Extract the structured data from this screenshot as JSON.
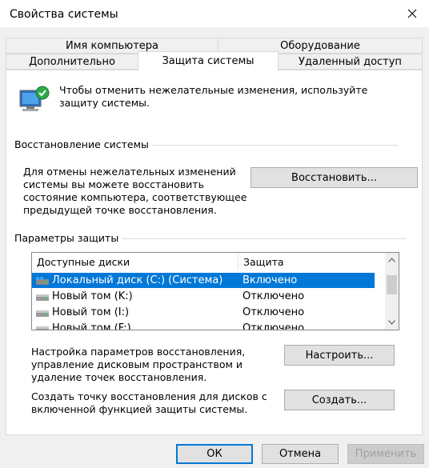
{
  "window": {
    "title": "Свойства системы"
  },
  "tabs_back": [
    "Имя компьютера",
    "Оборудование"
  ],
  "tabs_front": [
    "Дополнительно",
    "Защита системы",
    "Удаленный доступ"
  ],
  "intro": {
    "line1": "Чтобы отменить нежелательные изменения, используйте",
    "line2": "защиту системы."
  },
  "restore": {
    "header": "Восстановление системы",
    "desc": [
      "Для отмены нежелательных изменений",
      "системы вы можете восстановить",
      "состояние компьютера, соответствующее",
      "предыдущей точке восстановления."
    ],
    "button": "Восстановить..."
  },
  "protection": {
    "header": "Параметры защиты",
    "columns": [
      "Доступные диски",
      "Защита"
    ],
    "rows": [
      {
        "name": "Локальный диск (C:) (Система)",
        "status": "Включено",
        "selected": true,
        "icon": "system-drive-icon"
      },
      {
        "name": "Новый том (K:)",
        "status": "Отключено",
        "selected": false,
        "icon": "drive-icon"
      },
      {
        "name": "Новый том (I:)",
        "status": "Отключено",
        "selected": false,
        "icon": "drive-icon"
      },
      {
        "name": "Новый том (F:)",
        "status": "Отключено",
        "selected": false,
        "icon": "drive-icon"
      }
    ],
    "configure_desc": [
      "Настройка параметров восстановления,",
      "управление дисковым пространством и",
      "удаление точек восстановления."
    ],
    "configure_button": "Настроить...",
    "create_desc": [
      "Создать точку восстановления для дисков с",
      "включенной функцией защиты системы."
    ],
    "create_button": "Создать..."
  },
  "footer": {
    "ok": "ОК",
    "cancel": "Отмена",
    "apply": "Применить"
  },
  "colors": {
    "accent": "#0078d7",
    "background": "#f0f0f0"
  }
}
